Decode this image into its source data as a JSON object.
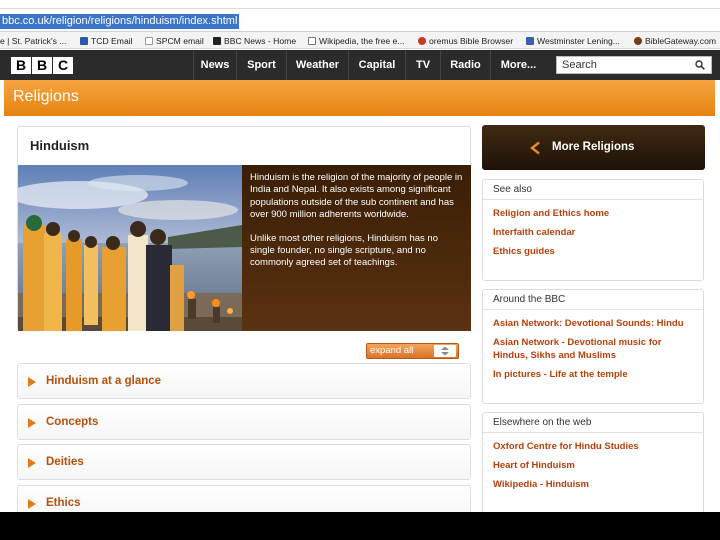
{
  "browser": {
    "url": "bbc.co.uk/religion/religions/hinduism/index.shtml",
    "bookmarks": [
      {
        "label": "e | St. Patrick's ...",
        "icon": "page-icon",
        "color": "#c9c9c9"
      },
      {
        "label": "TCD Email",
        "icon": "tcd-icon",
        "color": "#2b5aa8"
      },
      {
        "label": "SPCM email",
        "icon": "page-icon",
        "color": "#d9d9d9"
      },
      {
        "label": "BBC News - Home",
        "icon": "bbc-icon",
        "color": "#222222"
      },
      {
        "label": "Wikipedia, the free e...",
        "icon": "wikipedia-icon",
        "color": "#777777"
      },
      {
        "label": "oremus Bible Browser",
        "icon": "oremus-icon",
        "color": "#c23b22"
      },
      {
        "label": "Westminster Lening...",
        "icon": "westminster-icon",
        "color": "#3a5fb0"
      },
      {
        "label": "BibleGateway.com",
        "icon": "biblegateway-icon",
        "color": "#7a3a1a"
      }
    ]
  },
  "bbc_nav": {
    "logo": [
      "B",
      "B",
      "C"
    ],
    "items": [
      "News",
      "Sport",
      "Weather",
      "Capital",
      "TV",
      "Radio",
      "More..."
    ],
    "search_placeholder": "Search"
  },
  "section": {
    "title": "Religions"
  },
  "main": {
    "title": "Hinduism",
    "intro": [
      "Hinduism is the religion of the majority of people in India and Nepal. It also exists among significant populations outside of the sub continent and has over 900 million adherents worldwide.",
      "Unlike most other religions, Hinduism has no single founder, no single scripture, and no commonly agreed set of teachings."
    ],
    "expand_label": "expand all",
    "sections": [
      "Hinduism at a glance",
      "Concepts",
      "Deities",
      "Ethics"
    ]
  },
  "sidebar": {
    "more_religions": "More Religions",
    "see_also": {
      "heading": "See also",
      "links": [
        "Religion and Ethics home",
        "Interfaith calendar",
        "Ethics guides"
      ]
    },
    "around_bbc": {
      "heading": "Around the BBC",
      "links": [
        "Asian Network: Devotional Sounds: Hindu",
        "Asian Network - Devotional music for Hindus, Sikhs and Muslims",
        "In pictures - Life at the temple"
      ]
    },
    "elsewhere": {
      "heading": "Elsewhere on the web",
      "links": [
        "Oxford Centre for Hindu Studies",
        "Heart of Hinduism",
        "Wikipedia - Hinduism"
      ]
    }
  },
  "colors": {
    "accent": "#e48310",
    "link": "#b8400b",
    "nav_bg": "#2b2b2b",
    "intro_bg": "#3a1e06"
  }
}
